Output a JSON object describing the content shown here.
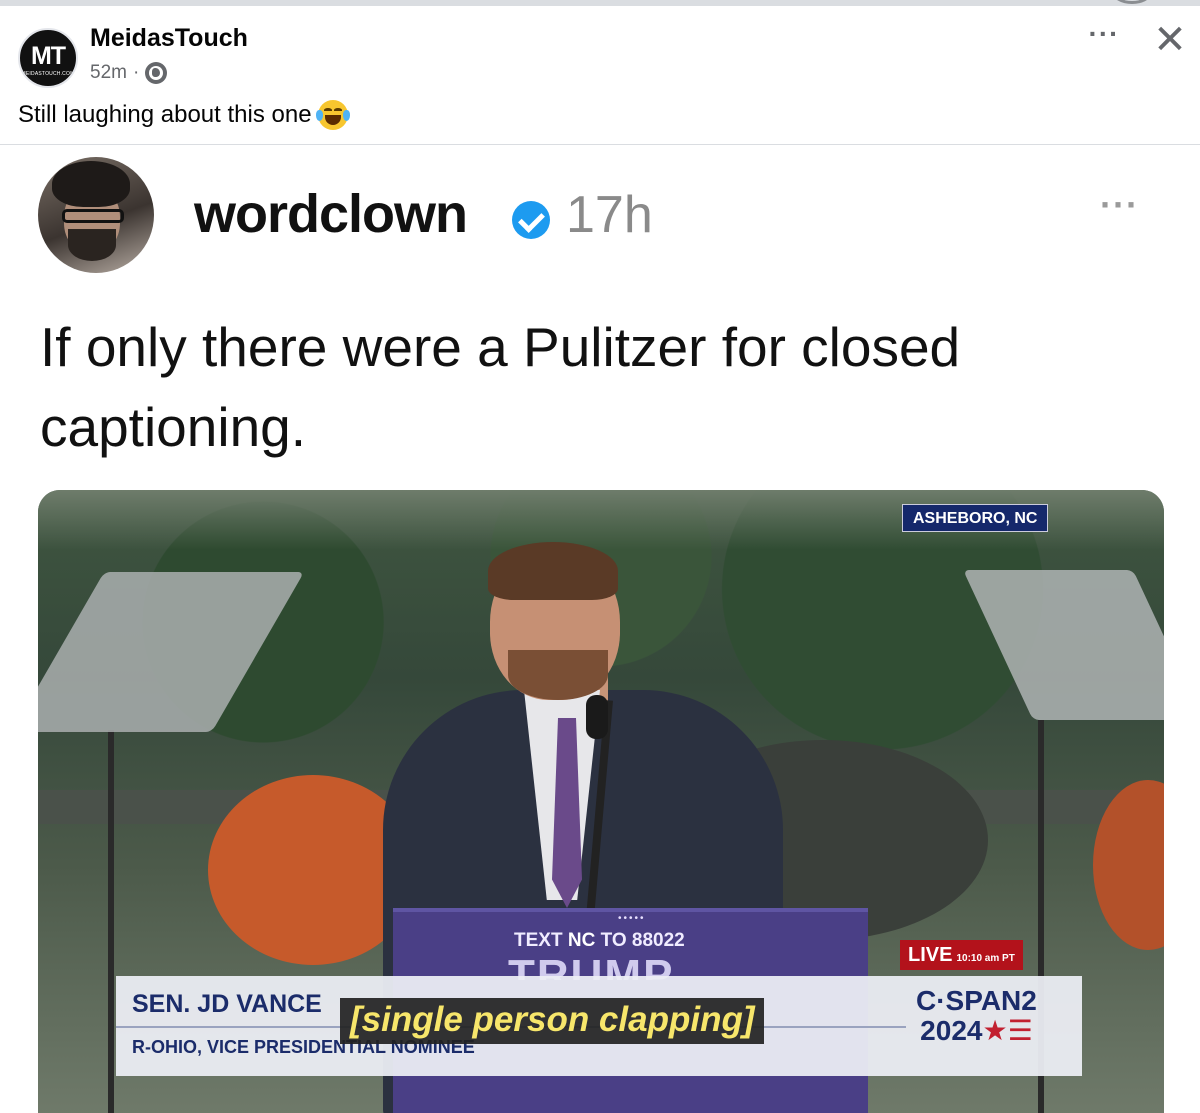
{
  "facebook_post": {
    "page_name": "MeidasTouch",
    "avatar_initials": "MT",
    "avatar_subtext": "MEIDASTOUCH.COM",
    "timestamp": "52m",
    "separator": "·",
    "privacy_icon": "globe-icon",
    "more_label": "···",
    "close_label": "✕",
    "caption_text": "Still laughing about this one",
    "caption_emoji": "face-with-tears-of-joy"
  },
  "embedded_post": {
    "username": "wordclown",
    "verified": true,
    "time": "17h",
    "more_label": "···",
    "body_line1": "If only there were a Pulitzer for closed",
    "body_line2": "captioning."
  },
  "video": {
    "location": "ASHEBORO, NC",
    "podium_stars": "•••••",
    "podium_text_pre": "TEXT ",
    "podium_text_nc": "NC",
    "podium_text_post": " TO 88022",
    "podium_brand": "TRUMP",
    "name_line": "SEN. JD VANCE",
    "role_line": "R-OHIO, VICE PRESIDENTIAL NOMINEE",
    "live_label": "LIVE",
    "live_time": "10:10 am PT",
    "network_line1": "C·SPAN2",
    "network_line2": "2024",
    "network_flag": "★☰",
    "closed_caption": "[single person clapping]"
  },
  "colors": {
    "fb_text": "#050505",
    "fb_meta": "#65676b",
    "verified_blue": "#1d9bf0",
    "cspan_navy": "#1b2c6a",
    "live_red": "#b3121b",
    "caption_yellow": "#f7e66b",
    "podium_purple": "#4a3f86"
  }
}
